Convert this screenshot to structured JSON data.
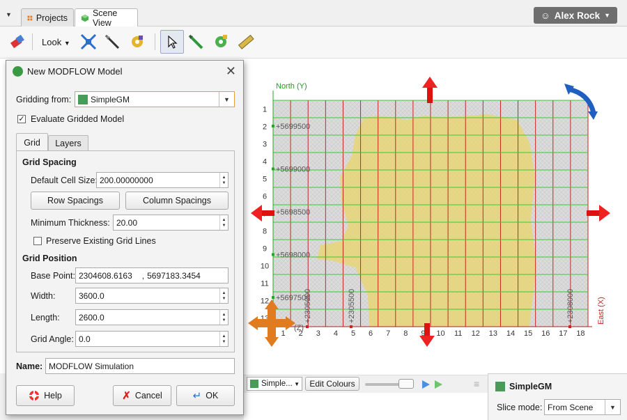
{
  "tabs": {
    "projects": "Projects",
    "scene": "Scene View"
  },
  "user": {
    "name": "Alex Rock"
  },
  "toolbar": {
    "look": "Look"
  },
  "dialog": {
    "title": "New MODFLOW Model",
    "gridding_from_label": "Gridding from:",
    "gridding_from_value": "SimpleGM",
    "evaluate_label": "Evaluate Gridded Model",
    "evaluate_checked": true,
    "tab_grid": "Grid",
    "tab_layers": "Layers",
    "grid_spacing_title": "Grid Spacing",
    "default_cell_label": "Default Cell Size:",
    "default_cell_value": "200.00000000",
    "row_spacings": "Row Spacings",
    "column_spacings": "Column Spacings",
    "min_thickness_label": "Minimum Thickness:",
    "min_thickness_value": "20.00",
    "preserve_label": "Preserve Existing Grid Lines",
    "grid_position_title": "Grid Position",
    "base_point_label": "Base Point:",
    "base_point_x": "2304608.6163",
    "base_point_sep": ",",
    "base_point_y": "5697183.3454",
    "width_label": "Width:",
    "width_value": "3600.0",
    "length_label": "Length:",
    "length_value": "2600.0",
    "grid_angle_label": "Grid Angle:",
    "grid_angle_value": "0.0",
    "name_label": "Name:",
    "name_value": "MODFLOW Simulation",
    "help": "Help",
    "cancel": "Cancel",
    "ok": "OK"
  },
  "scene": {
    "north_label": "North (Y)",
    "east_label": "East (X)",
    "z_label": "(Z)",
    "row_numbers": [
      "1",
      "2",
      "3",
      "4",
      "5",
      "6",
      "7",
      "8",
      "9",
      "10",
      "11",
      "12",
      "13"
    ],
    "col_numbers": [
      "1",
      "2",
      "3",
      "4",
      "5",
      "6",
      "7",
      "8",
      "9",
      "10",
      "11",
      "12",
      "13",
      "14",
      "15",
      "16",
      "17",
      "18"
    ],
    "y_ticks": [
      "+5699500",
      "+5699000",
      "+5698500",
      "+5698000",
      "+5697500"
    ],
    "x_ticks": [
      "+2305000",
      "+2305500",
      "+2308000"
    ],
    "colors": {
      "grid_rows": "#33cc33",
      "grid_cols": "#cc2222",
      "model": "#e8d66a",
      "arrow": "#dd1111",
      "rotate": "#1f5fbf"
    }
  },
  "bottom": {
    "object_value": "Simple...",
    "edit_colours": "Edit Colours"
  },
  "props": {
    "title": "SimpleGM",
    "slice_mode_label": "Slice mode:",
    "slice_mode_value": "From Scene"
  }
}
